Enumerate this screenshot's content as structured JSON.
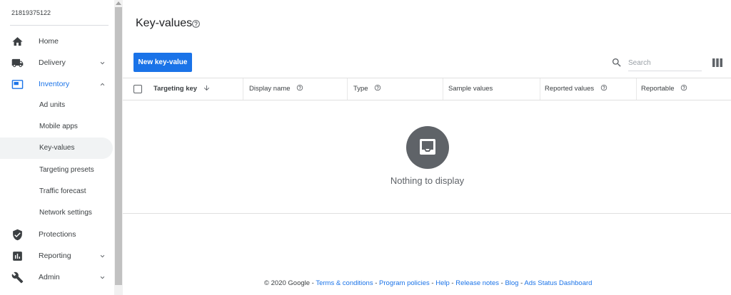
{
  "network_id": "21819375122",
  "sidebar": {
    "items": [
      {
        "label": "Home"
      },
      {
        "label": "Delivery"
      },
      {
        "label": "Inventory"
      },
      {
        "label": "Protections"
      },
      {
        "label": "Reporting"
      },
      {
        "label": "Admin"
      }
    ],
    "inventory_subitems": [
      {
        "label": "Ad units"
      },
      {
        "label": "Mobile apps"
      },
      {
        "label": "Key-values"
      },
      {
        "label": "Targeting presets"
      },
      {
        "label": "Traffic forecast"
      },
      {
        "label": "Network settings"
      }
    ]
  },
  "main": {
    "title": "Key-values",
    "new_button_label": "New key-value",
    "search_placeholder": "Search",
    "columns": [
      {
        "label": "Targeting key"
      },
      {
        "label": "Display name"
      },
      {
        "label": "Type"
      },
      {
        "label": "Sample values"
      },
      {
        "label": "Reported values"
      },
      {
        "label": "Reportable"
      }
    ],
    "empty_text": "Nothing to display"
  },
  "footer": {
    "copyright": "© 2020 Google",
    "sep": " - ",
    "links": [
      "Terms & conditions",
      "Program policies",
      "Help",
      "Release notes",
      "Blog",
      "Ads Status Dashboard"
    ]
  },
  "colors": {
    "accent": "#1a73e8",
    "icon_gray": "#5f6368"
  }
}
